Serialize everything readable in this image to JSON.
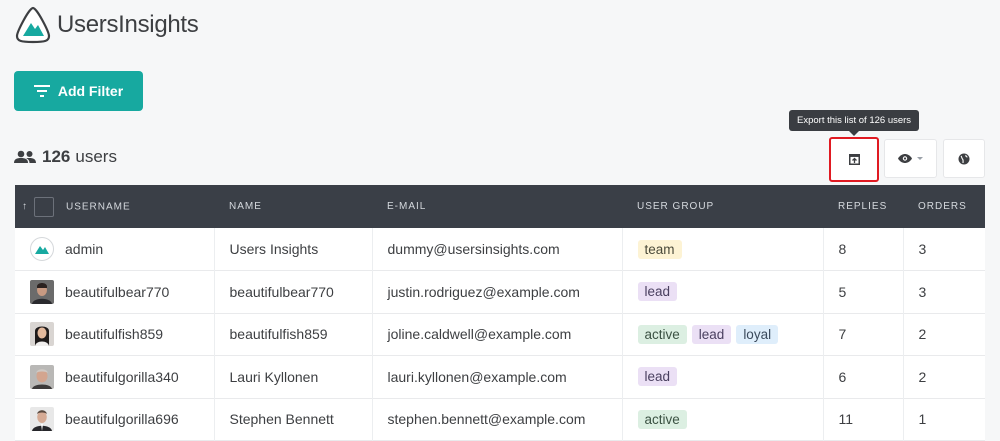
{
  "brand": {
    "name": "UsersInsights",
    "accent": "#17a9a0"
  },
  "toolbar": {
    "add_filter_label": "Add Filter",
    "export_tooltip": "Export this list of 126 users"
  },
  "summary": {
    "count": "126",
    "label": "users"
  },
  "table": {
    "columns": [
      "USERNAME",
      "NAME",
      "E-MAIL",
      "USER GROUP",
      "REPLIES",
      "ORDERS"
    ],
    "rows": [
      {
        "username": "admin",
        "name": "Users Insights",
        "email": "dummy@usersinsights.com",
        "groups": [
          "team"
        ],
        "replies": "8",
        "orders": "3",
        "avatar": "logo"
      },
      {
        "username": "beautifulbear770",
        "name": "beautifulbear770",
        "email": "justin.rodriguez@example.com",
        "groups": [
          "lead"
        ],
        "replies": "5",
        "orders": "3",
        "avatar": "photo"
      },
      {
        "username": "beautifulfish859",
        "name": "beautifulfish859",
        "email": "joline.caldwell@example.com",
        "groups": [
          "active",
          "lead",
          "loyal"
        ],
        "replies": "7",
        "orders": "2",
        "avatar": "photo"
      },
      {
        "username": "beautifulgorilla340",
        "name": "Lauri Kyllonen",
        "email": "lauri.kyllonen@example.com",
        "groups": [
          "lead"
        ],
        "replies": "6",
        "orders": "2",
        "avatar": "photo"
      },
      {
        "username": "beautifulgorilla696",
        "name": "Stephen Bennett",
        "email": "stephen.bennett@example.com",
        "groups": [
          "active"
        ],
        "replies": "11",
        "orders": "1",
        "avatar": "photo"
      }
    ]
  }
}
